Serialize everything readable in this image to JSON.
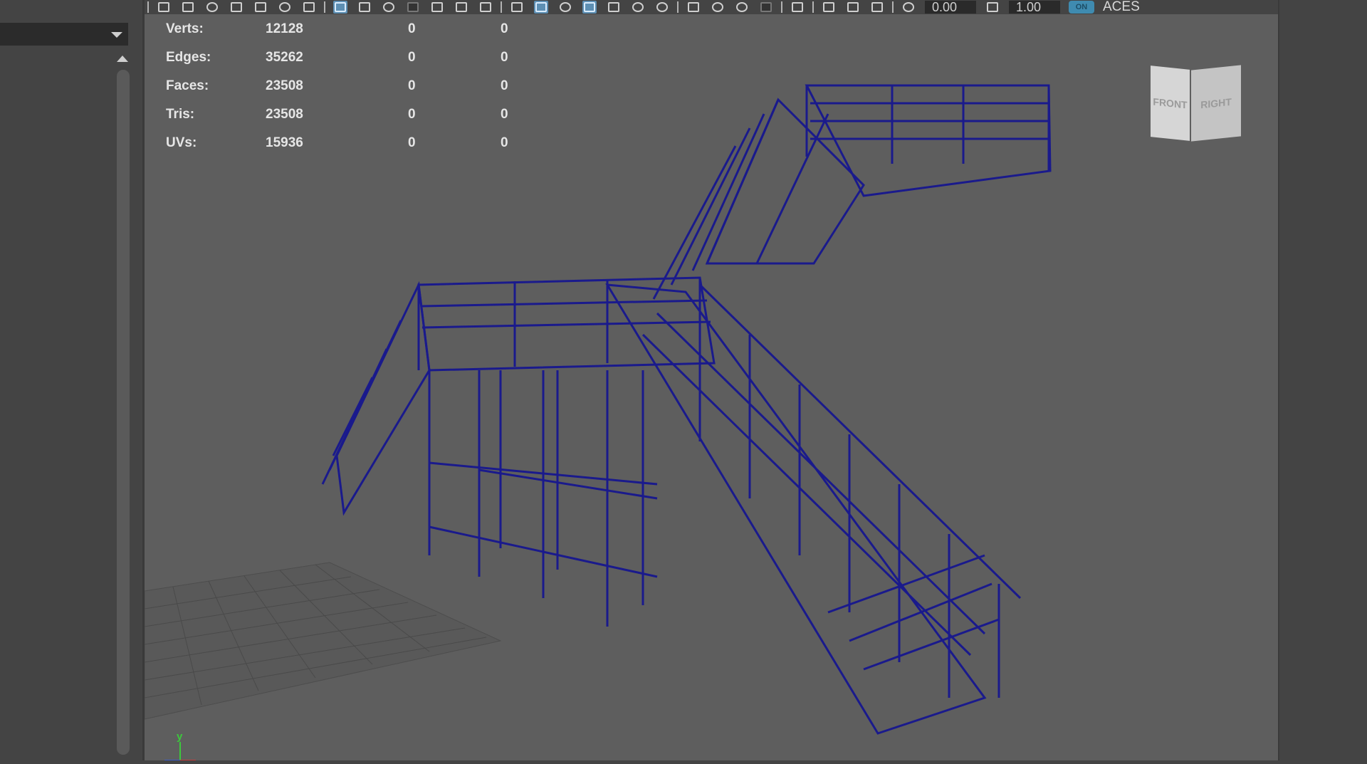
{
  "toolbar": {
    "exposure_value": "0.00",
    "gamma_value": "1.00",
    "colorspace_label": "ACES",
    "toggle_label": "ON"
  },
  "stats": {
    "rows": [
      {
        "label": "Verts:",
        "value": "12128",
        "a": "0",
        "b": "0"
      },
      {
        "label": "Edges:",
        "value": "35262",
        "a": "0",
        "b": "0"
      },
      {
        "label": "Faces:",
        "value": "23508",
        "a": "0",
        "b": "0"
      },
      {
        "label": "Tris:",
        "value": "23508",
        "a": "0",
        "b": "0"
      },
      {
        "label": "UVs:",
        "value": "15936",
        "a": "0",
        "b": "0"
      }
    ]
  },
  "view_cube": {
    "front": "FRONT",
    "right": "RIGHT"
  },
  "axis": {
    "y_label": "y"
  },
  "colors": {
    "wireframe": "#1a1a8c",
    "viewport_bg": "#5e5e5e",
    "grid": "#4a4a4a",
    "accent": "#3f8bb0"
  },
  "icons": [
    "camera-icon",
    "grid-icon",
    "wireframe-icon",
    "shaded-icon",
    "texture-icon",
    "lighting-icon",
    "isolate-icon",
    "exposure-icon",
    "gamma-icon"
  ]
}
